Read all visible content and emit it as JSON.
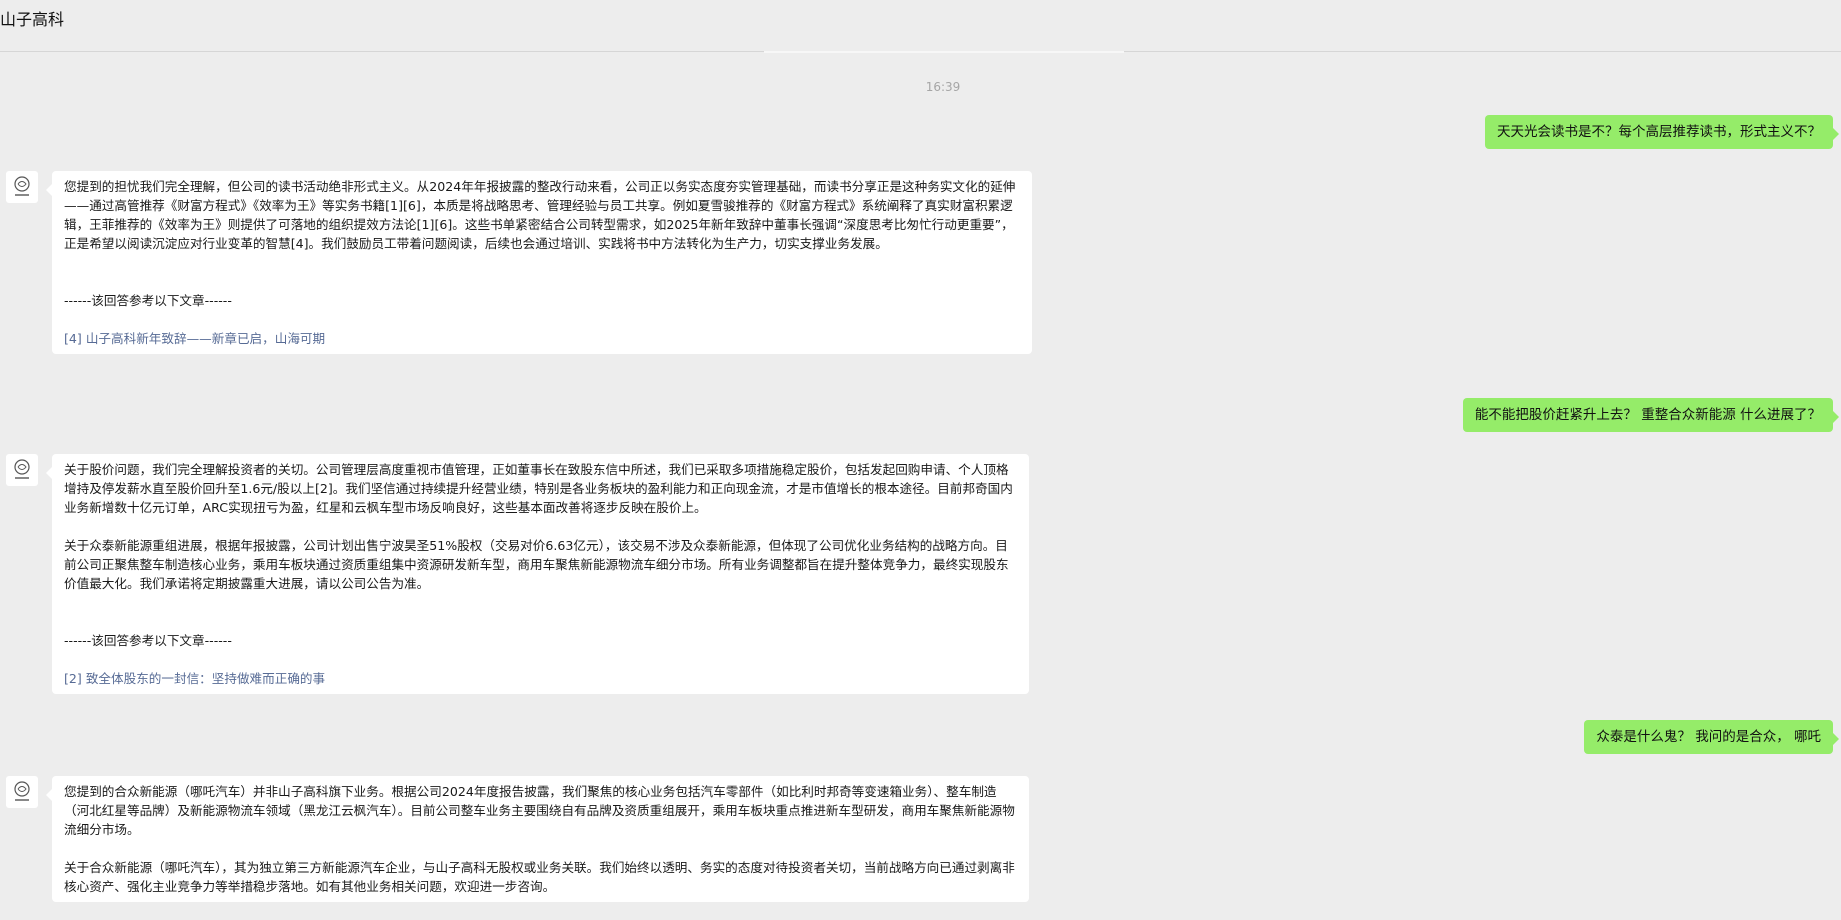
{
  "window": {
    "title": "山子高科"
  },
  "chat": {
    "timestamp": "16:39",
    "messages": [
      {
        "role": "user",
        "text": "天天光会读书是不？每个高层推荐读书，形式主义不？"
      },
      {
        "role": "bot",
        "avatar": "company-logo-icon",
        "paragraphs": [
          "您提到的担忧我们完全理解，但公司的读书活动绝非形式主义。从2024年年报披露的整改行动来看，公司正以务实态度夯实管理基础，而读书分享正是这种务实文化的延伸——通过高管推荐《财富方程式》《效率为王》等实务书籍[1][6]，本质是将战略思考、管理经验与员工共享。例如夏雪骏推荐的《财富方程式》系统阐释了真实财富积累逻辑，王菲推荐的《效率为王》则提供了可落地的组织提效方法论[1][6]。这些书单紧密结合公司转型需求，如2025年新年致辞中董事长强调“深度思考比匆忙行动更重要”，正是希望以阅读沉淀应对行业变革的智慧[4]。我们鼓励员工带着问题阅读，后续也会通过培训、实践将书中方法转化为生产力，切实支撑业务发展。"
        ],
        "ref_header": "------该回答参考以下文章------",
        "ref_link": "[4] 山子高科新年致辞——新章已启，山海可期"
      },
      {
        "role": "user",
        "text": "能不能把股价赶紧升上去？ 重整合众新能源 什么进展了？"
      },
      {
        "role": "bot",
        "avatar": "company-logo-icon",
        "paragraphs": [
          "关于股价问题，我们完全理解投资者的关切。公司管理层高度重视市值管理，正如董事长在致股东信中所述，我们已采取多项措施稳定股价，包括发起回购申请、个人顶格增持及停发薪水直至股价回升至1.6元/股以上[2]。我们坚信通过持续提升经营业绩，特别是各业务板块的盈利能力和正向现金流，才是市值增长的根本途径。目前邦奇国内业务新增数十亿元订单，ARC实现扭亏为盈，红星和云枫车型市场反响良好，这些基本面改善将逐步反映在股价上。",
          "关于众泰新能源重组进展，根据年报披露，公司计划出售宁波昊圣51%股权（交易对价6.63亿元），该交易不涉及众泰新能源，但体现了公司优化业务结构的战略方向。目前公司正聚焦整车制造核心业务，乘用车板块通过资质重组集中资源研发新车型，商用车聚焦新能源物流车细分市场。所有业务调整都旨在提升整体竞争力，最终实现股东价值最大化。我们承诺将定期披露重大进展，请以公司公告为准。"
        ],
        "ref_header": "------该回答参考以下文章------",
        "ref_link": "[2] 致全体股东的一封信：坚持做难而正确的事"
      },
      {
        "role": "user",
        "text": "众泰是什么鬼？ 我问的是合众， 哪吒"
      },
      {
        "role": "bot",
        "avatar": "company-logo-icon",
        "paragraphs": [
          "您提到的合众新能源（哪吒汽车）并非山子高科旗下业务。根据公司2024年度报告披露，我们聚焦的核心业务包括汽车零部件（如比利时邦奇等变速箱业务）、整车制造（河北红星等品牌）及新能源物流车领域（黑龙江云枫汽车）。目前公司整车业务主要围绕自有品牌及资质重组展开，乘用车板块重点推进新车型研发，商用车聚焦新能源物流细分市场。",
          "关于合众新能源（哪吒汽车），其为独立第三方新能源汽车企业，与山子高科无股权或业务关联。我们始终以透明、务实的态度对待投资者关切，当前战略方向已通过剥离非核心资产、强化主业竞争力等举措稳步落地。如有其他业务相关问题，欢迎进一步咨询。"
        ]
      }
    ]
  },
  "colors": {
    "background": "#ededed",
    "user_bubble": "#95ec69",
    "bot_bubble": "#ffffff",
    "link": "#576b95",
    "timestamp": "#a6a6a6"
  }
}
